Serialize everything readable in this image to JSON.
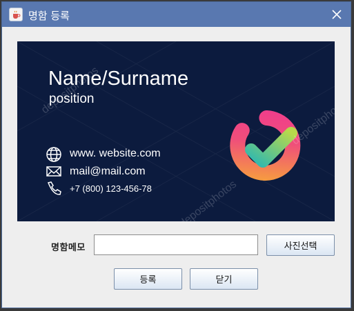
{
  "window": {
    "title": "명함 등록",
    "app_icon": "java-cup-icon",
    "close_icon": "close-icon"
  },
  "card_image": {
    "name": "Name/Surname",
    "position": "position",
    "website": "www. website.com",
    "email": "mail@mail.com",
    "phone": "+7 (800) 123-456-78",
    "watermark": "depositphotos",
    "background_color": "#0c1b3e",
    "icons": [
      "globe-icon",
      "envelope-icon",
      "phone-icon",
      "checkmark-logo-icon"
    ]
  },
  "form": {
    "memo_label": "명함메모",
    "memo_value": "",
    "photo_button": "사진선택",
    "register_button": "등록",
    "close_button": "닫기"
  }
}
